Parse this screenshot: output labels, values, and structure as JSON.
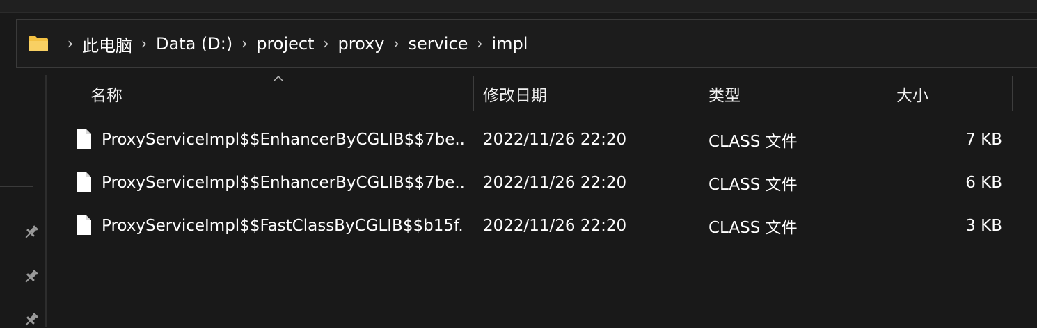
{
  "breadcrumb": {
    "items": [
      "此电脑",
      "Data (D:)",
      "project",
      "proxy",
      "service",
      "impl"
    ],
    "separator": "›"
  },
  "columns": {
    "name": "名称",
    "date": "修改日期",
    "type": "类型",
    "size": "大小"
  },
  "files": [
    {
      "name": "ProxyServiceImpl$$EnhancerByCGLIB$$7be...",
      "date": "2022/11/26 22:20",
      "type": "CLASS 文件",
      "size": "7 KB"
    },
    {
      "name": "ProxyServiceImpl$$EnhancerByCGLIB$$7be...",
      "date": "2022/11/26 22:20",
      "type": "CLASS 文件",
      "size": "6 KB"
    },
    {
      "name": "ProxyServiceImpl$$FastClassByCGLIB$$b15f...",
      "date": "2022/11/26 22:20",
      "type": "CLASS 文件",
      "size": "3 KB"
    }
  ],
  "icons": {
    "address_folder": "folder-icon",
    "file": "file-icon",
    "pin": "pin-icon",
    "sort": "sort-ascending-icon"
  },
  "colors": {
    "background": "#191919",
    "folder": "#f3c143",
    "text": "#ffffff"
  }
}
